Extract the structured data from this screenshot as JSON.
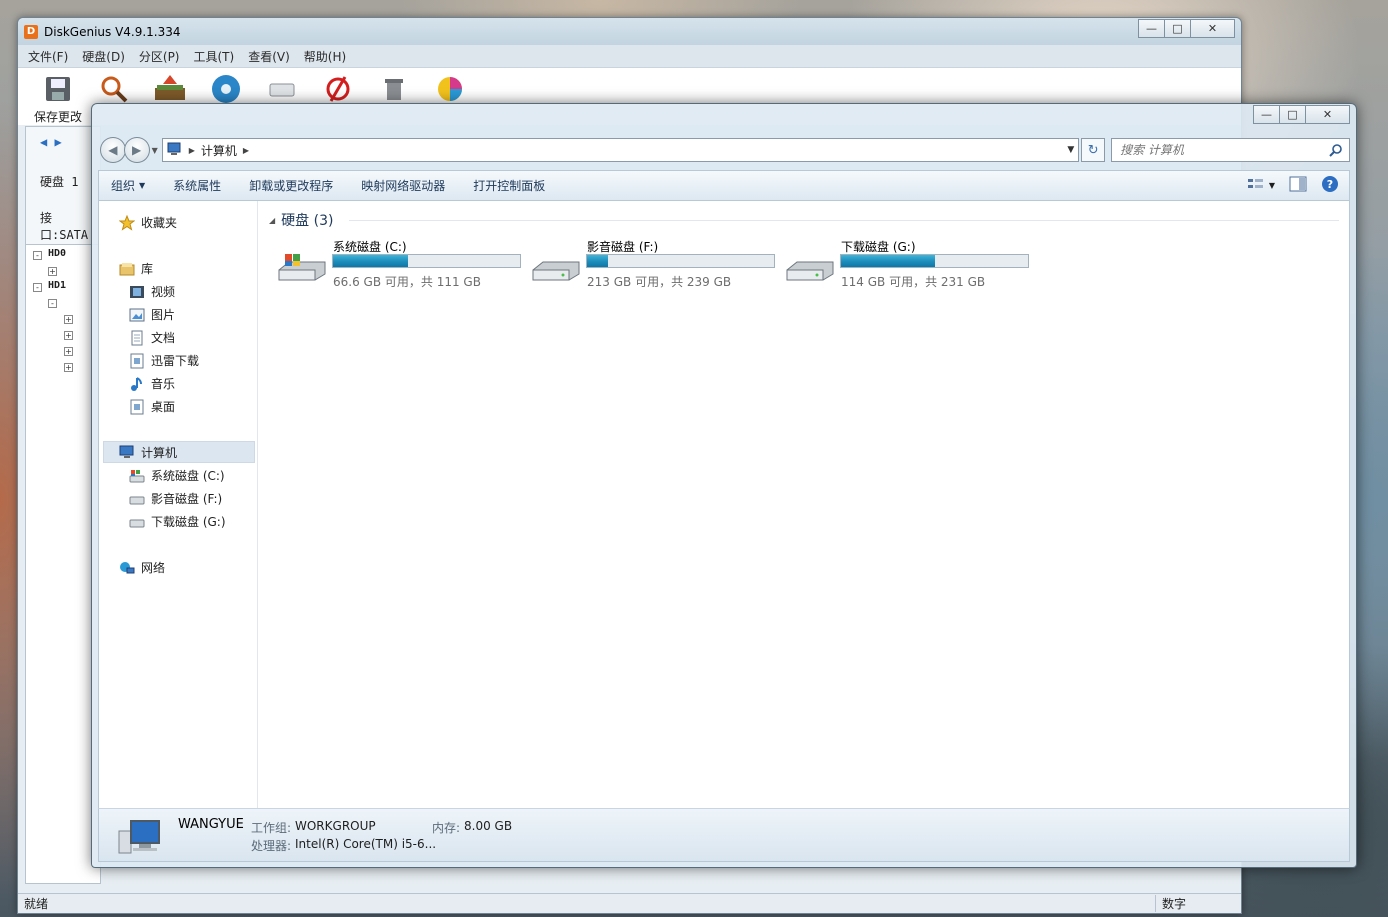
{
  "diskgenius": {
    "title": "DiskGenius V4.9.1.334",
    "logo_text": "D",
    "menu": [
      "文件(F)",
      "硬盘(D)",
      "分区(P)",
      "工具(T)",
      "查看(V)",
      "帮助(H)"
    ],
    "toolbar_first_label": "保存更改",
    "left_panel": {
      "disk_label": "硬盘 1",
      "interface_label": "接口:SATA"
    },
    "tree": [
      "HD0",
      "HD1"
    ],
    "status_left": "就绪",
    "status_right": "数字"
  },
  "explorer": {
    "address": {
      "root": "计算机"
    },
    "search_placeholder": "搜索 计算机",
    "commands": {
      "organize": "组织",
      "system_properties": "系统属性",
      "uninstall": "卸载或更改程序",
      "map_drive": "映射网络驱动器",
      "control_panel": "打开控制面板"
    },
    "nav": {
      "favorites": "收藏夹",
      "libraries": "库",
      "library_items": [
        "视频",
        "图片",
        "文档",
        "迅雷下载",
        "音乐",
        "桌面"
      ],
      "computer": "计算机",
      "drives": [
        "系统磁盘 (C:)",
        "影音磁盘 (F:)",
        "下载磁盘 (G:)"
      ],
      "network": "网络"
    },
    "group_title": "硬盘 (3)",
    "drives": [
      {
        "name": "系统磁盘 (C:)",
        "free_text": "66.6 GB 可用，共 111 GB",
        "used_fraction": 0.4,
        "system": true
      },
      {
        "name": "影音磁盘 (F:)",
        "free_text": "213 GB 可用，共 239 GB",
        "used_fraction": 0.11,
        "system": false
      },
      {
        "name": "下载磁盘 (G:)",
        "free_text": "114 GB 可用，共 231 GB",
        "used_fraction": 0.5,
        "system": false
      }
    ],
    "details": {
      "computer_name": "WANGYUE",
      "workgroup_label": "工作组:",
      "workgroup_value": "WORKGROUP",
      "memory_label": "内存:",
      "memory_value": "8.00 GB",
      "cpu_label": "处理器:",
      "cpu_value": "Intel(R) Core(TM) i5-6..."
    }
  },
  "colors": {
    "accent": "#1e395b",
    "bar_fill": "#1f8fbd",
    "dg_logo": "#e9711c"
  }
}
